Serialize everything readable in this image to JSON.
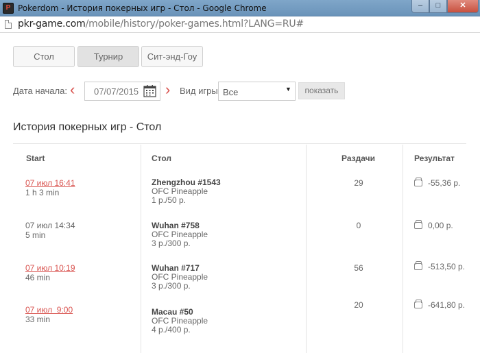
{
  "window": {
    "icon_text": "P",
    "title": "Pokerdom - История покерных игр - Стол - Google Chrome",
    "min_symbol": "–",
    "max_symbol": "□",
    "close_symbol": "✕"
  },
  "address": {
    "host": "pkr-game.com",
    "path": "/mobile/history/poker-games.html?LANG=RU#"
  },
  "tabs": [
    {
      "label": "Стол",
      "active": false
    },
    {
      "label": "Турнир",
      "active": true
    },
    {
      "label": "Сит-энд-Гоу",
      "active": false
    }
  ],
  "filters": {
    "start_label": "Дата начала:",
    "prev_arrow": "‹",
    "date_value": "07/07/2015",
    "next_arrow": "›",
    "game_type_label": "Вид игры:",
    "game_type_value": "Все",
    "caret": "▼",
    "show_button": "показать"
  },
  "section_title": "История покерных игр - Стол",
  "table": {
    "headers": {
      "start": "Start",
      "table": "Стол",
      "hands": "Раздачи",
      "result": "Результат"
    },
    "rows": [
      {
        "date": "07 июл 16:41",
        "linked": true,
        "duration": "1 h 3 min",
        "name": "Zhengzhou #1543",
        "game": "OFC Pineapple",
        "stakes": "1 р./50 р.",
        "hands": "29",
        "result": "-55,36 р."
      },
      {
        "date": "07 июл 14:34",
        "linked": false,
        "duration": "5 min",
        "name": "Wuhan #758",
        "game": "OFC Pineapple",
        "stakes": "3 р./300 р.",
        "hands": "0",
        "result": "0,00 р."
      },
      {
        "date": "07 июл 10:19",
        "linked": true,
        "duration": "46 min",
        "name": "Wuhan #717",
        "game": "OFC Pineapple",
        "stakes": "3 р./300 р.",
        "hands": "56",
        "result": "-513,50 р."
      },
      {
        "date": "07 июл  9:00",
        "linked": true,
        "duration": "33 min",
        "name": "Macau #50",
        "game": "OFC Pineapple",
        "stakes": "4 р./400 р.",
        "hands": "20",
        "result": "-641,80 р."
      }
    ]
  },
  "colors": {
    "accent_red": "#d9534f",
    "titlebar": "#7fa6c9"
  },
  "icons": {
    "calendar": "calendar-icon",
    "wallet": "wallet-icon",
    "page": "page-icon"
  }
}
